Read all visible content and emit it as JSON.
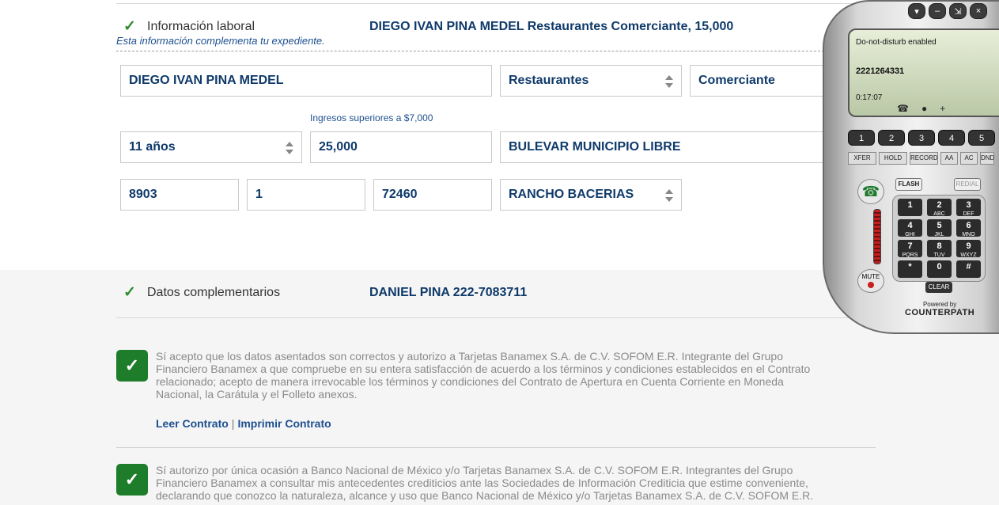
{
  "work_info": {
    "title": "Información laboral",
    "summary": "DIEGO IVAN PINA MEDEL Restaurantes Comerciante, 15,000",
    "subtitle": "Esta información complementa tu expediente.",
    "fields": {
      "employer": "DIEGO IVAN PINA MEDEL",
      "industry": "Restaurantes",
      "occupation": "Comerciante",
      "income_hint": "Ingresos superiores a $7,000",
      "seniority": "11 años",
      "income": "25,000",
      "street": "BULEVAR MUNICIPIO LIBRE",
      "ext_number": "8903",
      "int_number": "1",
      "zip": "72460",
      "neighborhood": "RANCHO BACERIAS"
    }
  },
  "complementary": {
    "title": "Datos complementarios",
    "summary": "DANIEL PINA 222-7083711"
  },
  "consents": [
    {
      "text": "Sí acepto que los datos asentados son correctos y autorizo a Tarjetas Banamex S.A. de C.V. SOFOM E.R. Integrante del Grupo Financiero Banamex a que compruebe en su entera satisfacción de acuerdo a los términos y condiciones establecidos en el Contrato relacionado; acepto de manera irrevocable los términos y condiciones del Contrato de Apertura en Cuenta Corriente en Moneda Nacional, la Carátula y el Folleto anexos."
    },
    {
      "text": "Sí autorizo por única ocasión a Banco Nacional de México y/o Tarjetas Banamex S.A. de C.V. SOFOM E.R. Integrantes del Grupo Financiero Banamex a consultar mis antecedentes crediticios ante las Sociedades de Información Crediticia que estime conveniente, declarando que conozco la naturaleza, alcance y uso que Banco Nacional de México y/o Tarjetas Banamex S.A. de C.V. SOFOM E.R."
    }
  ],
  "links": {
    "read": "Leer Contrato",
    "separator": "|",
    "print": "Imprimir Contrato"
  },
  "softphone": {
    "status": "Do-not-disturb enabled",
    "number": "2221264331",
    "timer": "0:17:07",
    "line_buttons": [
      "1",
      "2",
      "3",
      "4",
      "5"
    ],
    "func_buttons": [
      "XFER",
      "HOLD",
      "RECORD",
      "AA",
      "AC",
      "DND"
    ],
    "flash": "FLASH",
    "redial": "REDIAL",
    "mute": "MUTE",
    "clear": "CLEAR",
    "keys": [
      {
        "d": "1",
        "l": ""
      },
      {
        "d": "2",
        "l": "ABC"
      },
      {
        "d": "3",
        "l": "DEF"
      },
      {
        "d": "4",
        "l": "GHI"
      },
      {
        "d": "5",
        "l": "JKL"
      },
      {
        "d": "6",
        "l": "MNO"
      },
      {
        "d": "7",
        "l": "PQRS"
      },
      {
        "d": "8",
        "l": "TUV"
      },
      {
        "d": "9",
        "l": "WXYZ"
      },
      {
        "d": "*",
        "l": ""
      },
      {
        "d": "0",
        "l": ""
      },
      {
        "d": "#",
        "l": ""
      }
    ],
    "powered_by": "Powered by",
    "brand": "COUNTERPATH"
  }
}
